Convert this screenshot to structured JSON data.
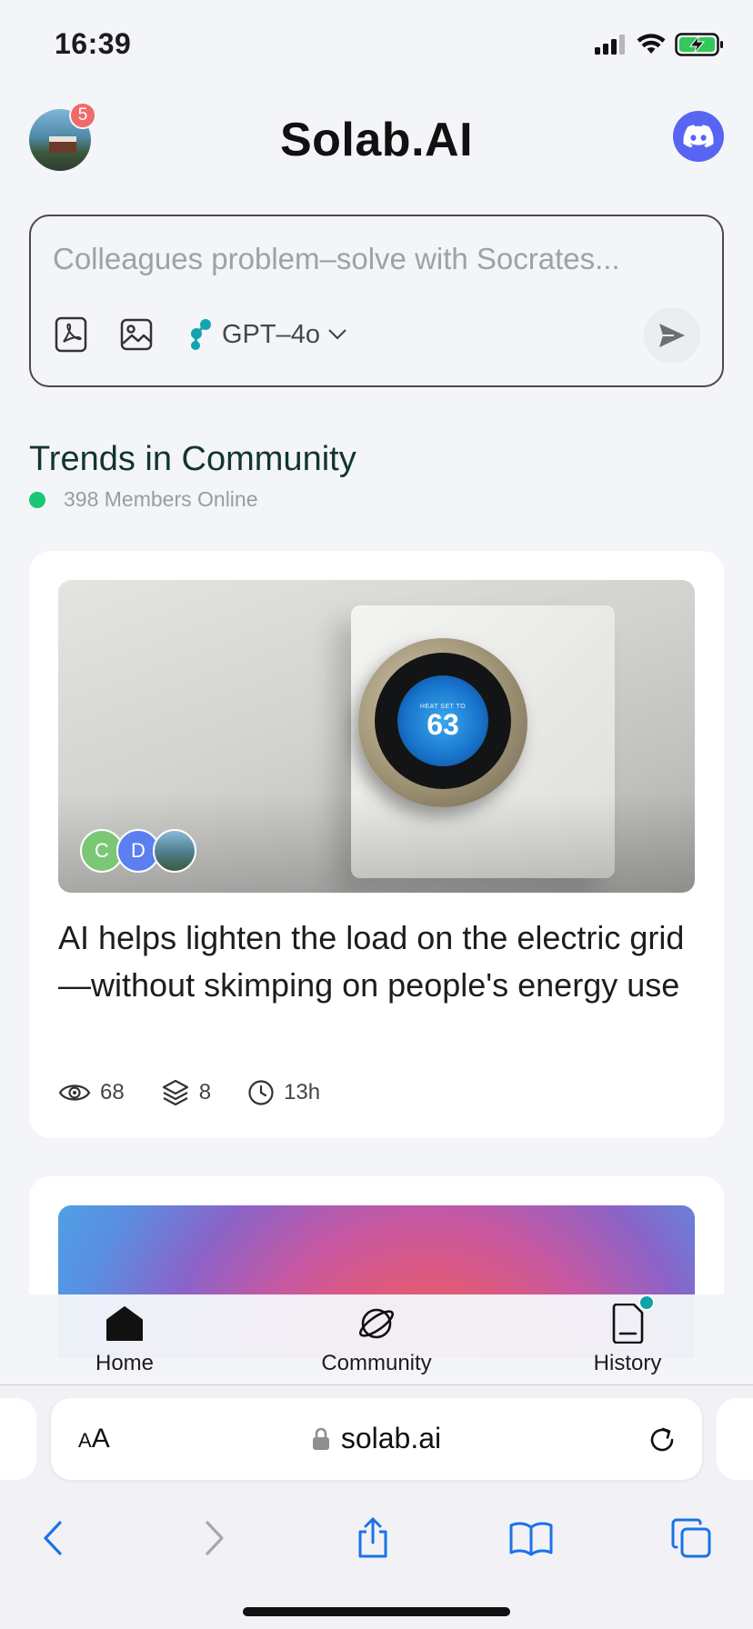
{
  "status_bar": {
    "time": "16:39",
    "battery_color": "#34c759"
  },
  "header": {
    "title": "Solab.AI",
    "notification_count": "5",
    "discord_color": "#5865f2"
  },
  "prompt": {
    "placeholder": "Colleagues problem–solve with Socrates...",
    "model": "GPT–4o",
    "tools": [
      "pdf-icon",
      "image-icon"
    ]
  },
  "community": {
    "title": "Trends in Community",
    "online_text": "398 Members Online"
  },
  "posts": [
    {
      "image_alt": "Nest thermostat on wall",
      "thermostat_label": "HEAT SET TO",
      "thermostat_value": "63",
      "participants": [
        "C",
        "D"
      ],
      "headline": "AI helps lighten the load on the electric grid—without skimping on people's energy use",
      "views": "68",
      "layers": "8",
      "time": "13h"
    }
  ],
  "tabbar": {
    "home": "Home",
    "community": "Community",
    "history": "History"
  },
  "browser": {
    "aa": "AA",
    "domain": "solab.ai"
  }
}
